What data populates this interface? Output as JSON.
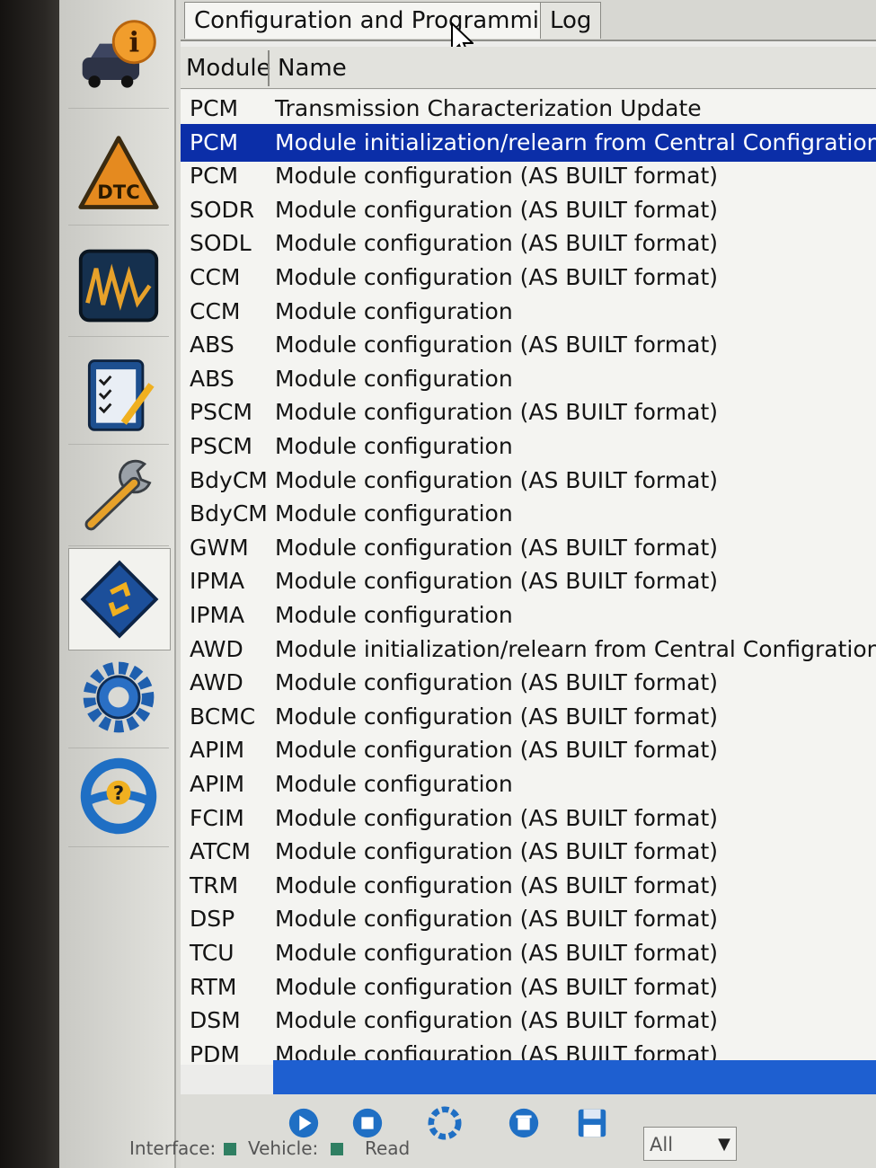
{
  "tabs": [
    {
      "label": "Configuration and Programming",
      "active": true
    },
    {
      "label": "Log",
      "active": false
    }
  ],
  "columns": {
    "module": "Module",
    "name": "Name"
  },
  "rows": [
    {
      "module": "PCM",
      "name": "Transmission Characterization Update"
    },
    {
      "module": "PCM",
      "name": "Module initialization/relearn from Central Configration",
      "selected": true
    },
    {
      "module": "PCM",
      "name": "Module configuration (AS BUILT format)"
    },
    {
      "module": "SODR",
      "name": "Module configuration (AS BUILT format)"
    },
    {
      "module": "SODL",
      "name": "Module configuration (AS BUILT format)"
    },
    {
      "module": "CCM",
      "name": "Module configuration (AS BUILT format)"
    },
    {
      "module": "CCM",
      "name": "Module configuration"
    },
    {
      "module": "ABS",
      "name": "Module configuration (AS BUILT format)"
    },
    {
      "module": "ABS",
      "name": "Module configuration"
    },
    {
      "module": "PSCM",
      "name": "Module configuration (AS BUILT format)"
    },
    {
      "module": "PSCM",
      "name": "Module configuration"
    },
    {
      "module": "BdyCM",
      "name": "Module configuration (AS BUILT format)"
    },
    {
      "module": "BdyCM",
      "name": "Module configuration"
    },
    {
      "module": "GWM",
      "name": "Module configuration (AS BUILT format)"
    },
    {
      "module": "IPMA",
      "name": "Module configuration (AS BUILT format)"
    },
    {
      "module": "IPMA",
      "name": "Module configuration"
    },
    {
      "module": "AWD",
      "name": "Module initialization/relearn from Central Configration"
    },
    {
      "module": "AWD",
      "name": "Module configuration (AS BUILT format)"
    },
    {
      "module": "BCMC",
      "name": "Module configuration (AS BUILT format)"
    },
    {
      "module": "APIM",
      "name": "Module configuration (AS BUILT format)"
    },
    {
      "module": "APIM",
      "name": "Module configuration"
    },
    {
      "module": "FCIM",
      "name": "Module configuration (AS BUILT format)"
    },
    {
      "module": "ATCM",
      "name": "Module configuration (AS BUILT format)"
    },
    {
      "module": "TRM",
      "name": "Module configuration (AS BUILT format)"
    },
    {
      "module": "DSP",
      "name": "Module configuration (AS BUILT format)"
    },
    {
      "module": "TCU",
      "name": "Module configuration (AS BUILT format)"
    },
    {
      "module": "RTM",
      "name": "Module configuration (AS BUILT format)"
    },
    {
      "module": "DSM",
      "name": "Module configuration (AS BUILT format)"
    },
    {
      "module": "PDM",
      "name": "Module configuration (AS BUILT format)"
    }
  ],
  "sidebar": {
    "icons": [
      "vehicle-info-icon",
      "dtc-warning-icon",
      "oscilloscope-icon",
      "checklist-icon",
      "wrench-icon",
      "module-chip-icon",
      "gear-icon",
      "steering-help-icon"
    ],
    "dtc_label": "DTC",
    "info_glyph": "i",
    "help_glyph": "?"
  },
  "toolbar": {
    "filter_value": "All",
    "icons": [
      "play-icon",
      "stop-icon",
      "lifebuoy-icon",
      "delete-icon",
      "save-icon"
    ]
  },
  "status": {
    "interface_label": "Interface:",
    "vehicle_label": "Vehicle:",
    "ready_label": "Read"
  },
  "colors": {
    "selection": "#0b2ea8",
    "accent_blue": "#1e5fd0",
    "warning_orange": "#e58a1f"
  }
}
